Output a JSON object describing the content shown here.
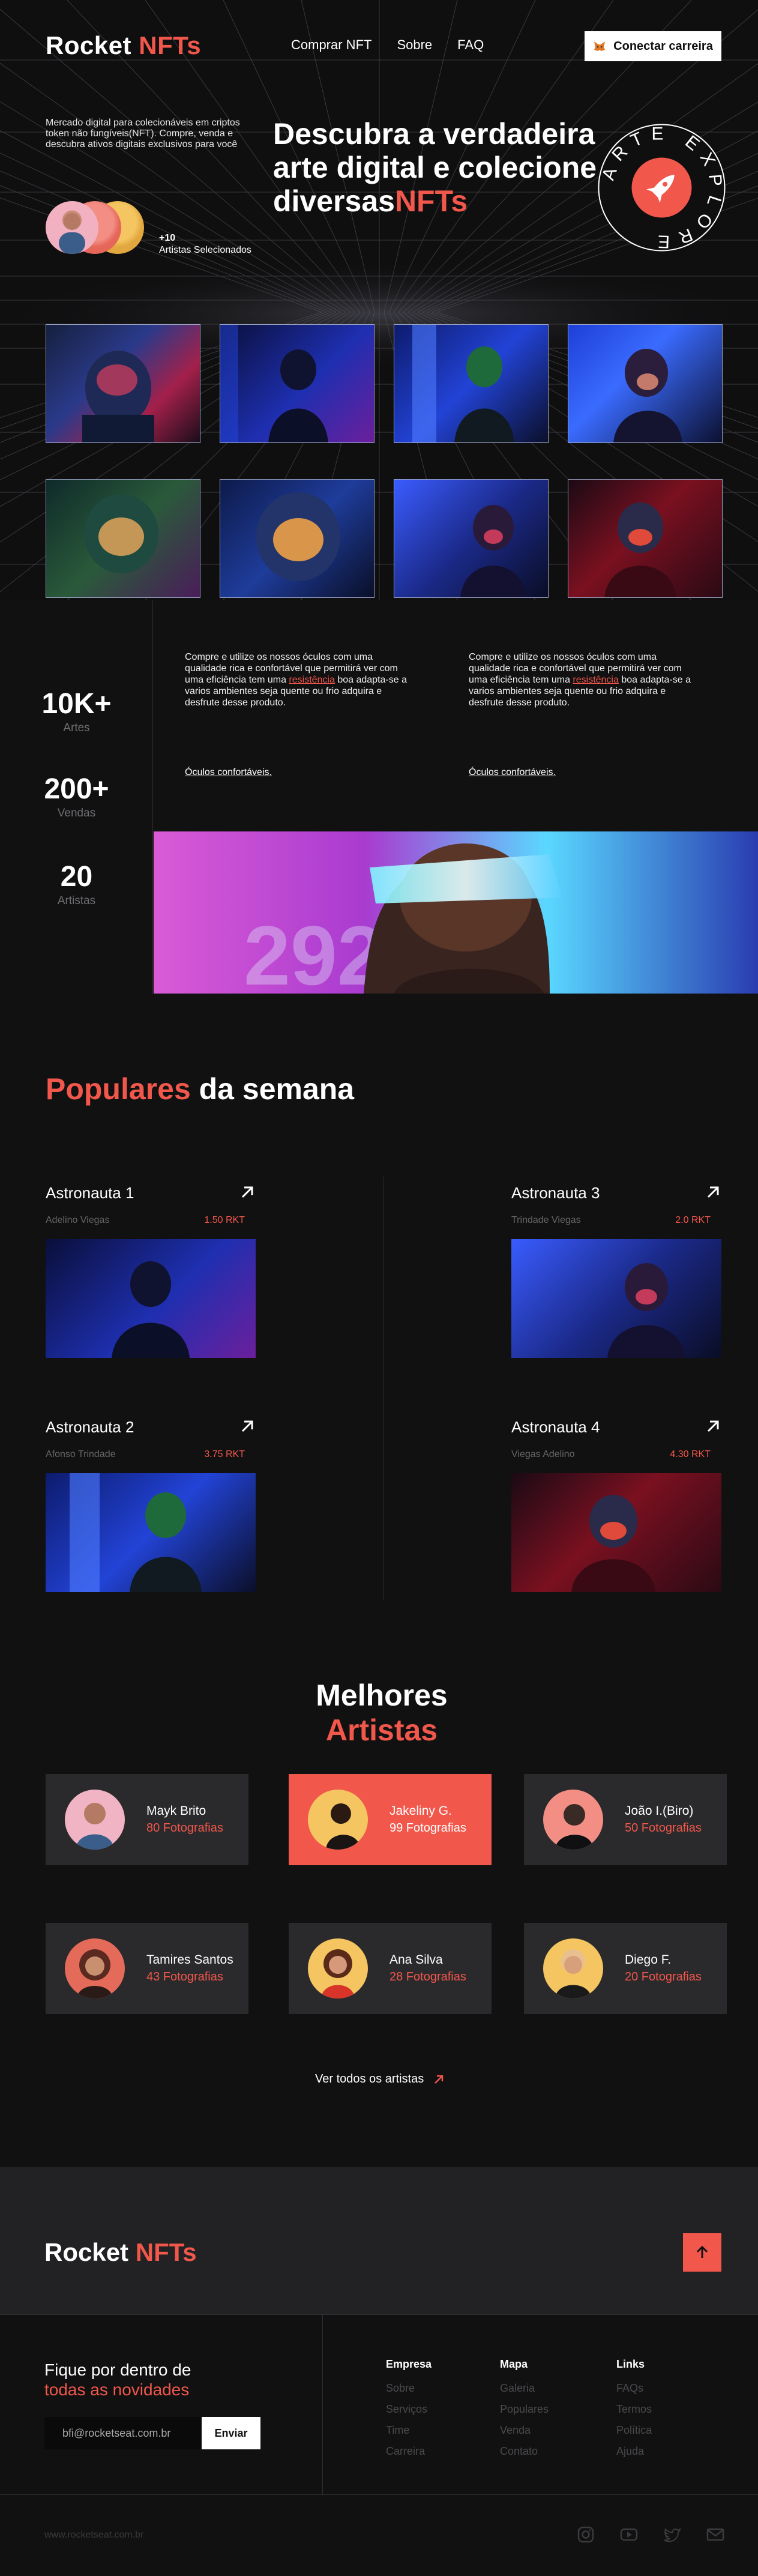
{
  "colors": {
    "accent": "#f1574b",
    "background": "#111112",
    "card": "#2a2a2c",
    "footer": "#222224"
  },
  "nav": {
    "logo_main": "Rocket",
    "logo_accent": "NFTs",
    "links": [
      "Comprar NFT",
      "Sobre",
      "FAQ"
    ],
    "connect_label": "Conectar carreira",
    "connect_icon": "metamask-fox-icon"
  },
  "hero": {
    "description": "Mercado digital para colecionáveis em criptos token não fungíveis(NFT). Compre, venda e descubra ativos digitais exclusivos para você",
    "selected_count": "+10",
    "selected_label": "Artistas Selecionados",
    "title_line1": "Descubra a verdadeira",
    "title_line2": "arte digital e colecione",
    "title_line3": "diversas",
    "title_accent": "NFTs",
    "badge_text": "ARTE EXPLORE",
    "badge_icon": "rocket-icon"
  },
  "stats": {
    "items": [
      {
        "value": "10K+",
        "label": "Artes"
      },
      {
        "value": "200+",
        "label": "Vendas"
      },
      {
        "value": "20",
        "label": "Artistas"
      }
    ],
    "text_before": "Compre e utilize os nossos óculos com uma qualidade rica e confortável que permitirá ver com uma eficiência tem uma ",
    "text_highlight": "resistência",
    "text_after": " boa adapta-se a varios ambientes seja quente ou frio adquira e desfrute desse produto.",
    "link": "Óculos confortáveis."
  },
  "popular": {
    "title_accent": "Populares",
    "title_rest": " da semana",
    "items": [
      {
        "name": "Astronauta 1",
        "author": "Adelino Viegas",
        "price": "1.50 RKT"
      },
      {
        "name": "Astronauta 3",
        "author": "Trindade Viegas",
        "price": "2.0 RKT"
      },
      {
        "name": "Astronauta 2",
        "author": "Afonso Trindade",
        "price": "3.75 RKT"
      },
      {
        "name": "Astronauta 4",
        "author": "Viegas Adelino",
        "price": "4.30 RKT"
      }
    ]
  },
  "artists": {
    "title_main": "Melhores ",
    "title_accent": "Artistas",
    "items": [
      {
        "name": "Mayk Brito",
        "photos": "80 Fotografias"
      },
      {
        "name": "Jakeliny G.",
        "photos": "99 Fotografias"
      },
      {
        "name": "João I.(Biro)",
        "photos": "50 Fotografias"
      },
      {
        "name": "Tamires Santos",
        "photos": "43 Fotografias"
      },
      {
        "name": "Ana Silva",
        "photos": "28 Fotografias"
      },
      {
        "name": "Diego F.",
        "photos": "20 Fotografias"
      }
    ],
    "see_all": "Ver todos os artistas"
  },
  "footer": {
    "logo_main": "Rocket",
    "logo_accent": "NFTs",
    "news_title": "Fique por dentro de",
    "news_accent": "todas as novidades",
    "email_value": "bfi@rocketseat.com.br",
    "send_label": "Enviar",
    "columns": [
      {
        "title": "Empresa",
        "items": [
          "Sobre",
          "Serviços",
          "Time",
          "Carreira"
        ]
      },
      {
        "title": "Mapa",
        "items": [
          "Galeria",
          "Populares",
          "Venda",
          "Contato"
        ]
      },
      {
        "title": "Links",
        "items": [
          "FAQs",
          "Termos",
          "Política",
          "Ajuda"
        ]
      }
    ],
    "url": "www.rocketseat.com.br",
    "social_icons": [
      "instagram-icon",
      "youtube-icon",
      "twitter-icon",
      "mail-icon"
    ]
  }
}
